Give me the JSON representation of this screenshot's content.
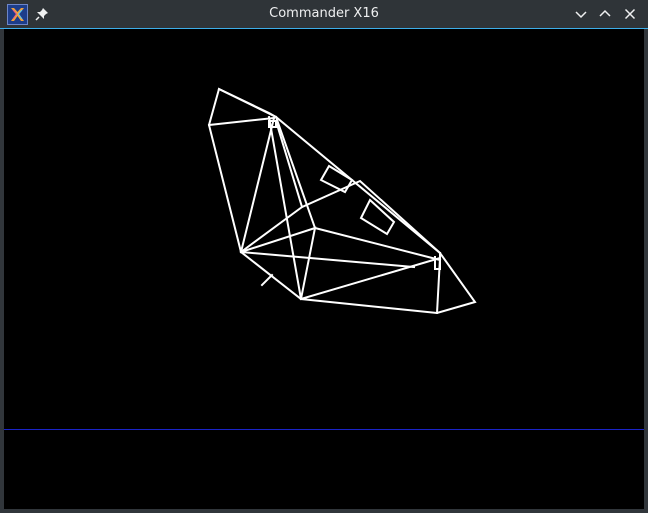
{
  "window": {
    "title": "Commander X16",
    "app_icon": "commander-x16-logo-icon",
    "pin_icon": "pin-icon",
    "minimize_icon": "chevron-down-icon",
    "maximize_icon": "chevron-up-icon",
    "close_icon": "close-icon"
  },
  "screen": {
    "background": "#000000",
    "wireframe_color": "#ffffff",
    "divider_color": "#1a24c8"
  },
  "colors": {
    "titlebar": "#2f3438",
    "accent": "#3daee9",
    "title_text": "#eff0f1"
  }
}
